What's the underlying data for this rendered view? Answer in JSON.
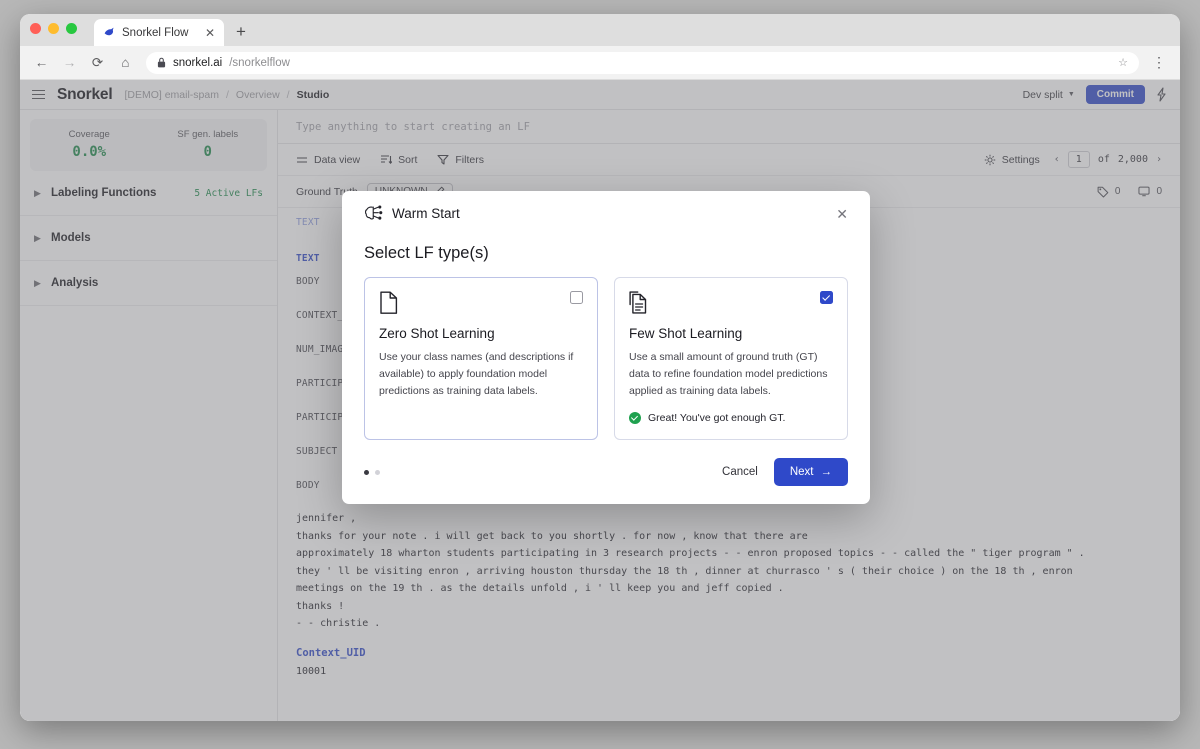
{
  "browser": {
    "tab": {
      "title": "Snorkel Flow",
      "close": "✕",
      "favicon": "snorkel-favicon"
    },
    "new_tab": "+",
    "nav": {
      "back": "←",
      "forward": "→",
      "reload": "⟳",
      "home": "⌂",
      "menu": "⋮",
      "star": "☆"
    },
    "url": {
      "lock": "🔒",
      "domain": "snorkel.ai",
      "path": "/snorkelflow"
    }
  },
  "appbar": {
    "brand": "Snorkel",
    "breadcrumbs": [
      {
        "label": "[DEMO] email-spam",
        "active": false
      },
      {
        "label": "Overview",
        "active": false
      },
      {
        "label": "Studio",
        "active": true
      }
    ],
    "separator": "/",
    "split_label": "Dev split",
    "commit_label": "Commit",
    "bolt_icon": "bolt-icon"
  },
  "sidebar": {
    "stats": [
      {
        "label": "Coverage",
        "value": "0.0%"
      },
      {
        "label": "SF gen. labels",
        "value": "0"
      }
    ],
    "sections": [
      {
        "label": "Labeling Functions",
        "badge": "5 Active LFs"
      },
      {
        "label": "Models",
        "badge": ""
      },
      {
        "label": "Analysis",
        "badge": ""
      }
    ]
  },
  "main": {
    "lf_input_placeholder": "Type anything to start creating an LF",
    "toolbar": {
      "data_view": "Data view",
      "sort": "Sort",
      "filters": "Filters",
      "settings": "Settings",
      "prev": "‹",
      "next": "›",
      "page": "1",
      "of": "of",
      "total": "2,000"
    },
    "ground_truth": {
      "label": "Ground Truth",
      "value": "UNKNOWN",
      "tag_count": "0",
      "comment_count": "0"
    },
    "fields": [
      {
        "name": "TEXT",
        "style": "hl-light"
      },
      {
        "name": "TEXT",
        "style": "hl"
      },
      {
        "name": "BODY",
        "style": ""
      },
      {
        "name": "CONTEXT_UID",
        "style": ""
      },
      {
        "name": "NUM_IMAGES",
        "style": ""
      },
      {
        "name": "PARTICIPANTS",
        "style": ""
      },
      {
        "name": "PARTICIPANT_IDS",
        "style": ""
      },
      {
        "name": "SUBJECT",
        "style": ""
      },
      {
        "name": "BODY",
        "style": ""
      }
    ],
    "record_body": "jennifer ,\nthanks for your note . i will get back to you shortly . for now , know that there are\napproximately 18 wharton students participating in 3 research projects - - enron proposed topics - - called the \" tiger program \" .\nthey ' ll be visiting enron , arriving houston thursday the 18 th , dinner at churrasco ' s ( their choice ) on the 18 th , enron\nmeetings on the 19 th . as the details unfold , i ' ll keep you and jeff copied .\nthanks !\n- - christie .",
    "context_uid_label": "Context_UID",
    "context_uid_value": "10001",
    "collapse_icon": "collapse-panel-icon"
  },
  "modal": {
    "icon": "warm-start-brain-icon",
    "title": "Warm Start",
    "close": "✕",
    "heading": "Select LF type(s)",
    "cards": [
      {
        "icon": "single-document-icon",
        "title": "Zero Shot Learning",
        "description": "Use your class names (and descriptions if available) to apply foundation model predictions as training data labels.",
        "checked": false,
        "note": ""
      },
      {
        "icon": "stacked-documents-icon",
        "title": "Few Shot Learning",
        "description": "Use a small amount of ground truth (GT) data to refine foundation model predictions applied as training data labels.",
        "checked": true,
        "note": "Great! You've got enough GT."
      }
    ],
    "step_dots": [
      true,
      false
    ],
    "cancel_label": "Cancel",
    "next_label": "Next",
    "next_arrow": "→"
  },
  "colors": {
    "accent": "#2f49c9",
    "success": "#1c8a4a",
    "muted": "#9b9ba0"
  }
}
